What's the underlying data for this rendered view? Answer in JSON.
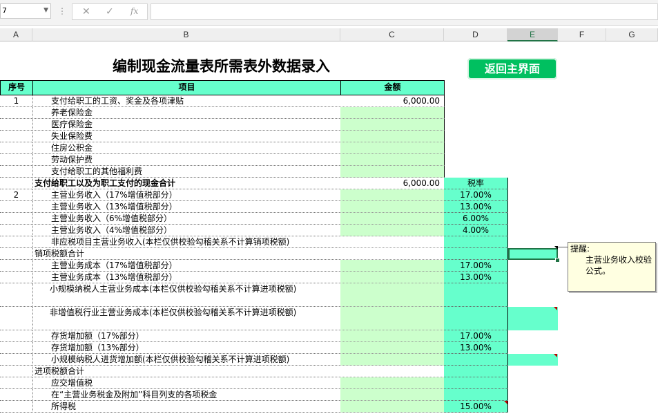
{
  "formula_bar": {
    "name_box_value": "7",
    "cancel_icon": "close-icon",
    "enter_icon": "check-icon",
    "function_label": "fx",
    "formula_value": ""
  },
  "columns": [
    "A",
    "B",
    "C",
    "D",
    "E",
    "F",
    "G"
  ],
  "selected_column": "E",
  "sheet": {
    "title": "编制现金流量表所需表外数据录入",
    "back_button": "返回主界面",
    "headers": {
      "seq": "序号",
      "item": "项目",
      "amount": "金额",
      "rate": "税率"
    },
    "rows": [
      {
        "seq": "1",
        "item": "支付给职工的工资、奖金及各项津贴",
        "amount": "6,000.00"
      },
      {
        "seq": "",
        "item": "养老保险金",
        "amount": ""
      },
      {
        "seq": "",
        "item": "医疗保险金",
        "amount": ""
      },
      {
        "seq": "",
        "item": "失业保险费",
        "amount": ""
      },
      {
        "seq": "",
        "item": "住房公积金",
        "amount": ""
      },
      {
        "seq": "",
        "item": "劳动保护费",
        "amount": ""
      },
      {
        "seq": "",
        "item": "支付给职工的其他福利费",
        "amount": ""
      },
      {
        "seq": "",
        "item": "支付给职工以及为职工支付的现金合计",
        "amount": "6,000.00"
      },
      {
        "seq": "2",
        "item": "主营业务收入（17%增值税部分）",
        "amount": "",
        "rate": "17.00%"
      },
      {
        "seq": "",
        "item": "主营业务收入（13%增值税部分）",
        "amount": "",
        "rate": "13.00%"
      },
      {
        "seq": "",
        "item": "主营业务收入（6%增值税部分）",
        "amount": "",
        "rate": "6.00%"
      },
      {
        "seq": "",
        "item": "主营业务收入（4%增值税部分）",
        "amount": "",
        "rate": "4.00%"
      },
      {
        "seq": "",
        "item": "非应税项目主营业务收入(本栏仅供校验勾稽关系不计算销项税额)",
        "amount": ""
      },
      {
        "seq": "",
        "item": "销项税额合计",
        "amount": ""
      },
      {
        "seq": "",
        "item": "主营业务成本（17%增值税部分）",
        "amount": "",
        "rate": "17.00%"
      },
      {
        "seq": "",
        "item": "主营业务成本（13%增值税部分）",
        "amount": "",
        "rate": "13.00%"
      },
      {
        "seq": "",
        "item": "小规模纳税人主营业务成本(本栏仅供校验勾稽关系不计算进项税额)",
        "amount": ""
      },
      {
        "seq": "",
        "item": "非增值税行业主营业务成本(本栏仅供校验勾稽关系不计算进项税额)",
        "amount": ""
      },
      {
        "seq": "",
        "item": "存货增加额（17%部分）",
        "amount": "",
        "rate": "17.00%"
      },
      {
        "seq": "",
        "item": "存货增加额（13%部分）",
        "amount": "",
        "rate": "13.00%"
      },
      {
        "seq": "",
        "item": "小规模纳税人进货增加额(本栏仅供校验勾稽关系不计算进项税额)",
        "amount": ""
      },
      {
        "seq": "",
        "item": "进项税额合计",
        "amount": ""
      },
      {
        "seq": "",
        "item": "应交增值税",
        "amount": ""
      },
      {
        "seq": "",
        "item": "在“主营业务税金及附加”科目列支的各项税金",
        "amount": ""
      },
      {
        "seq": "",
        "item": "所得税",
        "amount": "",
        "rate": "15.00%"
      }
    ]
  },
  "comment": {
    "title": "提醒:",
    "body": "主营业务收入校验公式。"
  },
  "colors": {
    "header_fill": "#66ffcc",
    "input_fill": "#ccffcc",
    "button_fill": "#00c060",
    "selection": "#217346",
    "comment_fill": "#ffffe1"
  }
}
